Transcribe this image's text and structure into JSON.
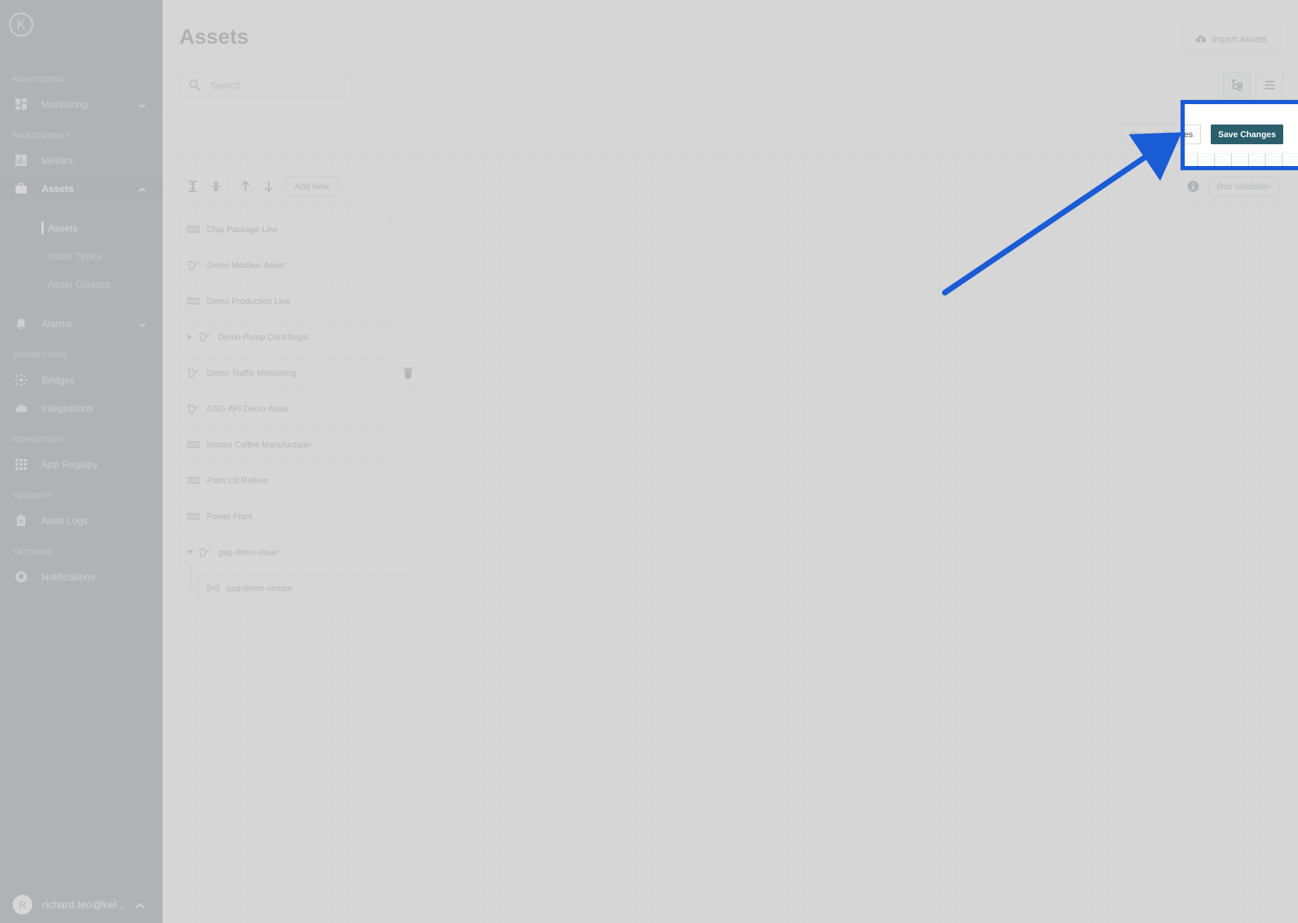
{
  "app": {
    "logo_letter": "K"
  },
  "sidebar": {
    "sections": {
      "monitoring": "MONITORING",
      "management": "MANAGEMENT",
      "connection": "CONNECTION",
      "repository": "REPOSITORY",
      "security": "SECURITY",
      "settings": "SETTINGS"
    },
    "items": {
      "monitoring": "Monitoring",
      "metrics": "Metrics",
      "assets": "Assets",
      "alarms": "Alarms",
      "bridges": "Bridges",
      "integrations": "Integrations",
      "app_registry": "App Registry",
      "audit_logs": "Audit Logs",
      "notifications": "Notifications"
    },
    "sub_items": {
      "assets": "Assets",
      "asset_types": "Asset Types",
      "asset_classes": "Asset Classes"
    },
    "user": {
      "initial": "R",
      "name": "richard.teo@kel..."
    }
  },
  "header": {
    "title": "Assets",
    "import_label": "Import Assets",
    "search_placeholder": "Search"
  },
  "edit_bar": {
    "discard_label": "Discard Changes",
    "save_label": "Save Changes"
  },
  "toolbar": {
    "add_new_label": "Add New",
    "run_validation_label": "Run validation"
  },
  "assets": [
    {
      "name": "Chip Package Line",
      "icon": "production-line-icon"
    },
    {
      "name": "Demo Modbus Asset",
      "icon": "asset-icon"
    },
    {
      "name": "Demo Production Line",
      "icon": "production-line-icon"
    },
    {
      "name": "Demo Pump Centrifugal",
      "icon": "asset-icon",
      "expandable": true
    },
    {
      "name": "Demo Traffic Monitoring",
      "icon": "asset-icon"
    },
    {
      "name": "GSG API Demo Asset",
      "icon": "asset-icon"
    },
    {
      "name": "Instant Coffee Manufacturer",
      "icon": "production-line-icon"
    },
    {
      "name": "Palm Oil Refiner",
      "icon": "production-line-icon"
    },
    {
      "name": "Power Plant",
      "icon": "production-line-icon"
    },
    {
      "name": "gsg-demo-asset",
      "icon": "asset-icon",
      "expanded": true
    },
    {
      "name": "gsg-demo-sensor",
      "icon": "sensor-icon",
      "child": true
    }
  ],
  "colors": {
    "sidebar_bg": "#2f3a3f",
    "accent": "#00939c",
    "callout": "#1a5bd6"
  }
}
